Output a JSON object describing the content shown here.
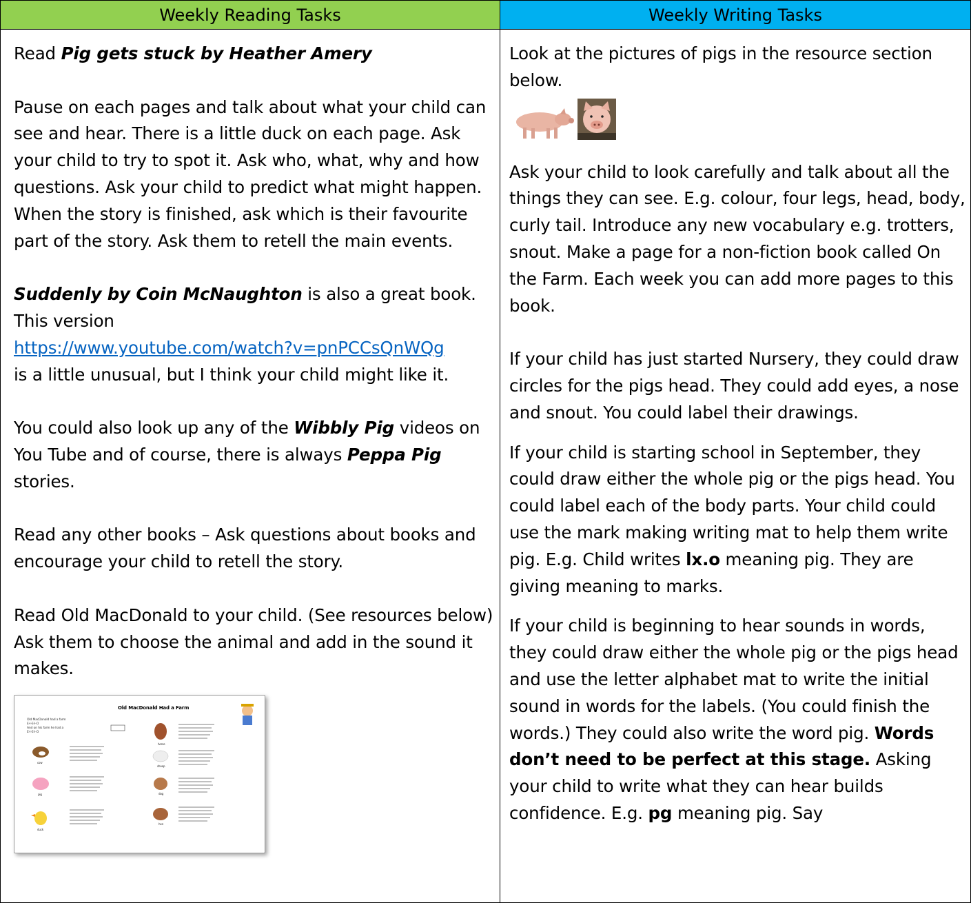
{
  "headers": {
    "reading": "Weekly Reading Tasks",
    "writing": "Weekly Writing Tasks"
  },
  "colors": {
    "reading_header_bg": "#92d050",
    "writing_header_bg": "#00b0f0",
    "link": "#0563c1"
  },
  "reading": {
    "p1_pre": "Read ",
    "p1_title": "Pig gets stuck by Heather Amery",
    "p2": "Pause on each pages and talk about what your child can see and hear. There is a little duck on each page. Ask your child to try to spot it. Ask who, what, why and how questions. Ask your child to predict what might happen. When the story is finished, ask which is their favourite part of the story. Ask them to retell the main events.",
    "p3_title": "Suddenly by Coin McNaughton",
    "p3_mid": " is also a great book. This version",
    "p3_link": "https://www.youtube.com/watch?v=pnPCCsQnWQg",
    "p3_post": "is a little unusual, but I think your child might like it.",
    "p4_pre": "You could also look up any of the ",
    "p4_t1": "Wibbly Pig",
    "p4_mid": " videos on You Tube and of course, there is always ",
    "p4_t2": "Peppa Pig",
    "p4_post": " stories.",
    "p5": "Read any other books – Ask questions about books and encourage your child to retell the story.",
    "p6": "Read Old MacDonald to your child. (See resources below) Ask them to choose the animal and add in the sound it makes.",
    "worksheet": {
      "title": "Old MacDonald Had a Farm",
      "intro": [
        "Old MacDonald had a farm",
        "E-I-E-I-O",
        "And on his farm he had a",
        "E-I-E-I-O"
      ],
      "animals": [
        "cow",
        "horse",
        "sheep",
        "pig",
        "dog",
        "duck",
        "hen"
      ]
    }
  },
  "writing": {
    "p1": "Look at the pictures of pigs in the resource section below.",
    "p2": "Ask your child to look carefully and talk about all the things they can see. E.g. colour, four legs, head, body, curly tail. Introduce any new vocabulary e.g. trotters, snout. Make a page for a non-fiction book called On the Farm. Each week you can add more pages to this book.",
    "p3": "If your child has just started Nursery, they could draw circles for the pigs head. They could add eyes, a nose and snout. You could label their drawings.",
    "p4_pre": "If your child is starting school in September, they could draw either the whole pig or the pigs head. You could label each of the body parts. Your child could use the mark making writing mat to help them write pig. E.g. Child writes ",
    "p4_bold": "lx.o",
    "p4_post": " meaning pig. They are giving meaning to marks.",
    "p5_pre": "If your child is beginning to hear sounds in words, they could draw either the whole pig or the pigs head and use the letter alphabet mat to write the initial sound in words for the labels. (You could finish the words.) They could also write the word pig. ",
    "p5_bold": "Words don’t need to be perfect at this stage.",
    "p5_mid": " Asking your child to write what they can hear builds confidence. E.g. ",
    "p5_bold2": "pg",
    "p5_post": " meaning pig. Say"
  }
}
